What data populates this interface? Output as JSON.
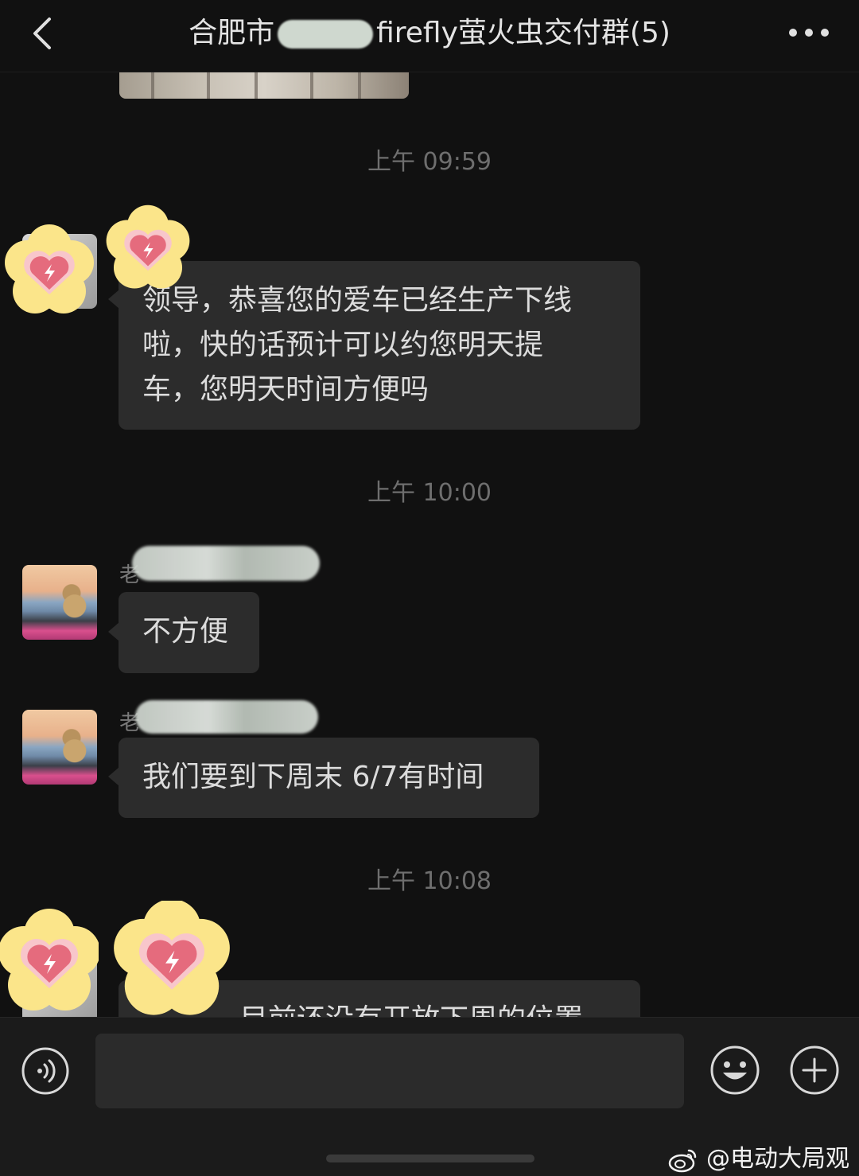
{
  "header": {
    "title": "合肥市 firefly萤火虫交付群(5)",
    "title_prefix": "合肥市",
    "title_suffix": "firefly萤火虫交付群(5)",
    "back_icon": "chevron-left-icon",
    "more_icon": "more-dots-icon"
  },
  "messages": [
    {
      "type": "time",
      "text": "上午 09:59"
    },
    {
      "type": "message",
      "sender_prefix": "",
      "text_lines": [
        "领导，恭喜您的爱车已经生产下线",
        "啦，快的话预计可以约您明天提",
        "车，您明天时间方便吗"
      ]
    },
    {
      "type": "time",
      "text": "上午 10:00"
    },
    {
      "type": "message",
      "sender_prefix": "老",
      "text": "不方便"
    },
    {
      "type": "message",
      "sender_prefix": "老",
      "text": "我们要到下周末 6/7有时间"
    },
    {
      "type": "time",
      "text": "上午 10:08"
    },
    {
      "type": "message",
      "text": "目前还没有开放下周的位置"
    }
  ],
  "input_bar": {
    "placeholder": "",
    "voice_icon": "voice-icon",
    "emoji_icon": "emoji-icon",
    "plus_icon": "plus-icon"
  },
  "watermark": {
    "text": "@电动大局观",
    "icon": "weibo-icon"
  },
  "colors": {
    "background": "#111111",
    "bubble": "#2c2c2c",
    "time_text": "#6e6e6e",
    "sticker_heart": "#e56b7d",
    "sticker_flower": "#fbe58a"
  }
}
